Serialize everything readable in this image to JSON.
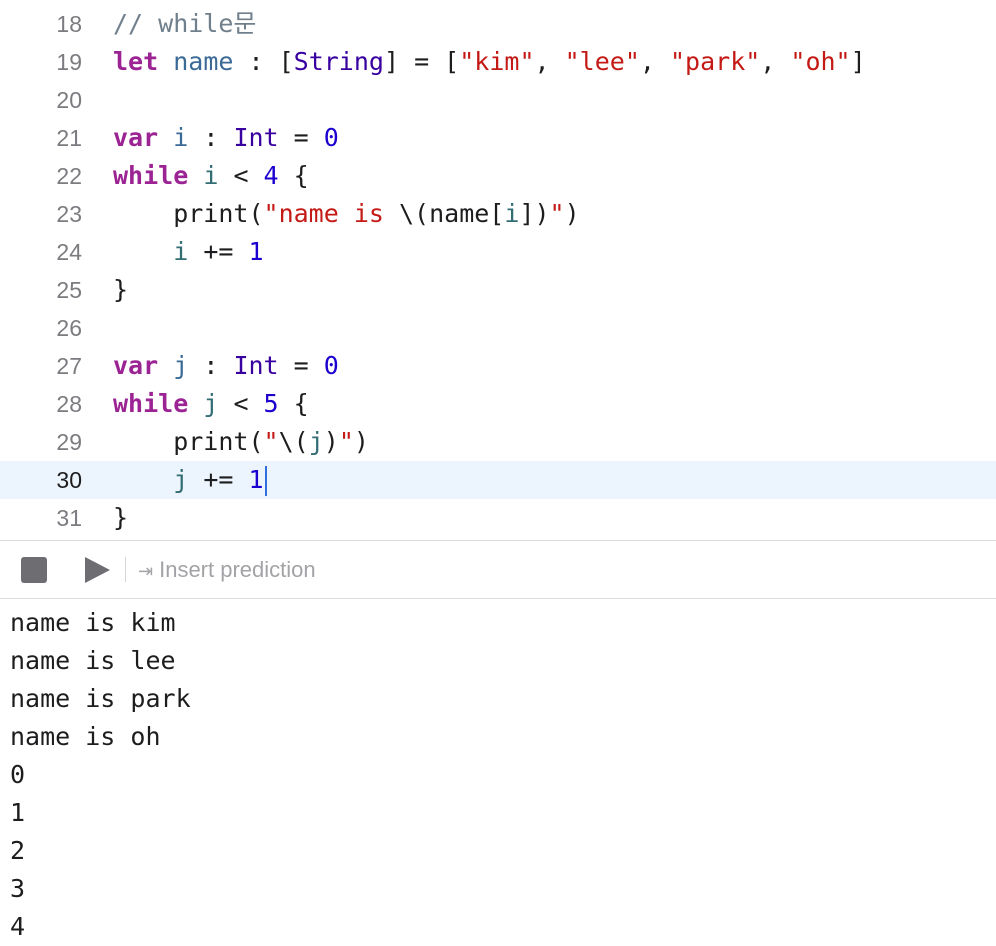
{
  "editor": {
    "lines": [
      {
        "number": "18",
        "tokens": [
          {
            "text": "// while문",
            "color": "#707f8c"
          }
        ]
      },
      {
        "number": "19",
        "tokens": [
          {
            "text": "let",
            "color": "#9b2393",
            "bold": true
          },
          {
            "text": " "
          },
          {
            "text": "name",
            "color": "#3b6a96"
          },
          {
            "text": " : ["
          },
          {
            "text": "String",
            "color": "#3900a0"
          },
          {
            "text": "] = ["
          },
          {
            "text": "\"kim\"",
            "color": "#c41a16"
          },
          {
            "text": ", "
          },
          {
            "text": "\"lee\"",
            "color": "#c41a16"
          },
          {
            "text": ", "
          },
          {
            "text": "\"park\"",
            "color": "#c41a16"
          },
          {
            "text": ", "
          },
          {
            "text": "\"oh\"",
            "color": "#c41a16"
          },
          {
            "text": "]"
          }
        ]
      },
      {
        "number": "20",
        "tokens": []
      },
      {
        "number": "21",
        "tokens": [
          {
            "text": "var",
            "color": "#9b2393",
            "bold": true
          },
          {
            "text": " "
          },
          {
            "text": "i",
            "color": "#3b6a96"
          },
          {
            "text": " : "
          },
          {
            "text": "Int",
            "color": "#3900a0"
          },
          {
            "text": " = "
          },
          {
            "text": "0",
            "color": "#1c00cf"
          }
        ]
      },
      {
        "number": "22",
        "tokens": [
          {
            "text": "while",
            "color": "#9b2393",
            "bold": true
          },
          {
            "text": " "
          },
          {
            "text": "i",
            "color": "#326d74"
          },
          {
            "text": " < "
          },
          {
            "text": "4",
            "color": "#1c00cf"
          },
          {
            "text": " {"
          }
        ]
      },
      {
        "number": "23",
        "tokens": [
          {
            "text": "    print("
          },
          {
            "text": "\"name is ",
            "color": "#c41a16"
          },
          {
            "text": "\\(name["
          },
          {
            "text": "i",
            "color": "#326d74"
          },
          {
            "text": "])"
          },
          {
            "text": "\"",
            "color": "#c41a16"
          },
          {
            "text": ")"
          }
        ]
      },
      {
        "number": "24",
        "tokens": [
          {
            "text": "    "
          },
          {
            "text": "i",
            "color": "#326d74"
          },
          {
            "text": " += "
          },
          {
            "text": "1",
            "color": "#1c00cf"
          }
        ]
      },
      {
        "number": "25",
        "tokens": [
          {
            "text": "}"
          }
        ]
      },
      {
        "number": "26",
        "tokens": []
      },
      {
        "number": "27",
        "tokens": [
          {
            "text": "var",
            "color": "#9b2393",
            "bold": true
          },
          {
            "text": " "
          },
          {
            "text": "j",
            "color": "#3b6a96"
          },
          {
            "text": " : "
          },
          {
            "text": "Int",
            "color": "#3900a0"
          },
          {
            "text": " = "
          },
          {
            "text": "0",
            "color": "#1c00cf"
          }
        ]
      },
      {
        "number": "28",
        "tokens": [
          {
            "text": "while",
            "color": "#9b2393",
            "bold": true
          },
          {
            "text": " "
          },
          {
            "text": "j",
            "color": "#326d74"
          },
          {
            "text": " < "
          },
          {
            "text": "5",
            "color": "#1c00cf"
          },
          {
            "text": " {"
          }
        ]
      },
      {
        "number": "29",
        "tokens": [
          {
            "text": "    print("
          },
          {
            "text": "\"",
            "color": "#c41a16"
          },
          {
            "text": "\\("
          },
          {
            "text": "j",
            "color": "#326d74"
          },
          {
            "text": ")"
          },
          {
            "text": "\"",
            "color": "#c41a16"
          },
          {
            "text": ")"
          }
        ]
      },
      {
        "number": "30",
        "current": true,
        "tokens": [
          {
            "text": "    "
          },
          {
            "text": "j",
            "color": "#326d74"
          },
          {
            "text": " += "
          },
          {
            "text": "1",
            "color": "#1c00cf"
          }
        ]
      },
      {
        "number": "31",
        "tokens": [
          {
            "text": "}"
          }
        ]
      }
    ]
  },
  "toolbar": {
    "stop_icon": "stop-icon",
    "run_icon": "play-icon",
    "prediction_icon": "tab-arrow-icon",
    "prediction_label": "Insert prediction"
  },
  "console": {
    "lines": [
      "name is kim",
      "name is lee",
      "name is park",
      "name is oh",
      "0",
      "1",
      "2",
      "3",
      "4"
    ]
  }
}
